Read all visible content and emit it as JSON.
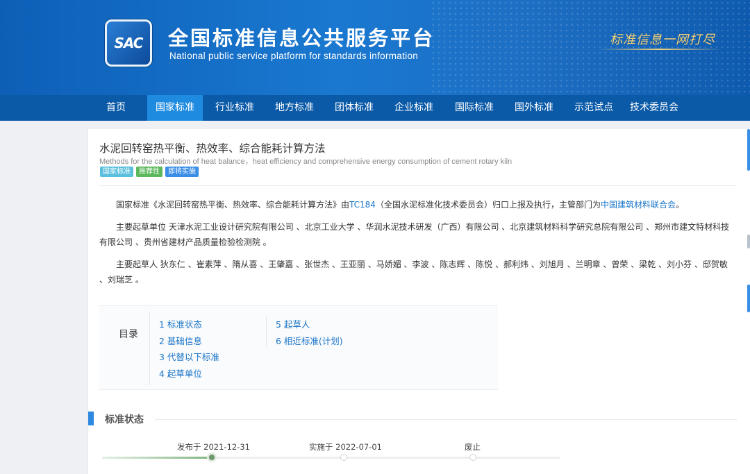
{
  "header": {
    "logo_text": "SAC",
    "title": "全国标准信息公共服务平台",
    "subtitle": "National public service platform  for standards information",
    "slogan": "标准信息一网打尽"
  },
  "nav": {
    "items": [
      {
        "label": "首页"
      },
      {
        "label": "国家标准"
      },
      {
        "label": "行业标准"
      },
      {
        "label": "地方标准"
      },
      {
        "label": "团体标准"
      },
      {
        "label": "企业标准"
      },
      {
        "label": "国际标准"
      },
      {
        "label": "国外标准"
      },
      {
        "label": "示范试点"
      },
      {
        "label": "技术委员会"
      }
    ],
    "active": "国家标准"
  },
  "document": {
    "title": "水泥回转窑热平衡、热效率、综合能耗计算方法",
    "title_en": "Methods for the calculation of heat balance，heat efficiency and comprehensive energy consumption of cement rotary kiln",
    "tags": [
      {
        "label": "国家标准",
        "color": "#5bc0de"
      },
      {
        "label": "推荐性",
        "color": "#5cb85c"
      },
      {
        "label": "即将实施",
        "color": "#3a8ee6"
      }
    ],
    "intro": {
      "prefix": "国家标准《水泥回转窑热平衡、热效率、综合能耗计算方法》由",
      "tc_link": "TC184",
      "middle": "（全国水泥标准化技术委员会）归口上报及执行，主管部门为",
      "dept_link": "中国建筑材料联合会",
      "suffix": "。"
    },
    "units_text": "主要起草单位 天津水泥工业设计研究院有限公司 、北京工业大学 、华润水泥技术研发（广西）有限公司 、北京建筑材料科学研究总院有限公司 、郑州市建文特材科技有限公司 、贵州省建材产品质量检验检测院 。",
    "drafters_text": "主要起草人 狄东仁 、崔素萍 、隋从喜 、王肇嘉 、张世杰 、王亚丽 、马娇媚 、李波 、陈志辉 、陈悦 、郝利炜 、刘旭月 、兰明章 、曾荣 、梁乾 、刘小芬 、邸贺敏 、刘瑞芝 。"
  },
  "toc": {
    "label": "目录",
    "items": [
      {
        "label": "1  标准状态"
      },
      {
        "label": "2  基础信息"
      },
      {
        "label": "3  代替以下标准"
      },
      {
        "label": "4  起草单位"
      },
      {
        "label": "5  起草人"
      },
      {
        "label": "6  相近标准(计划)"
      }
    ]
  },
  "status_section": {
    "title": "标准状态",
    "timeline": [
      {
        "label": "发布于 2021-12-31",
        "done": true
      },
      {
        "label": "实施于 2022-07-01",
        "done": false
      },
      {
        "label": "废止",
        "done": false
      }
    ],
    "progress": 0.24
  }
}
